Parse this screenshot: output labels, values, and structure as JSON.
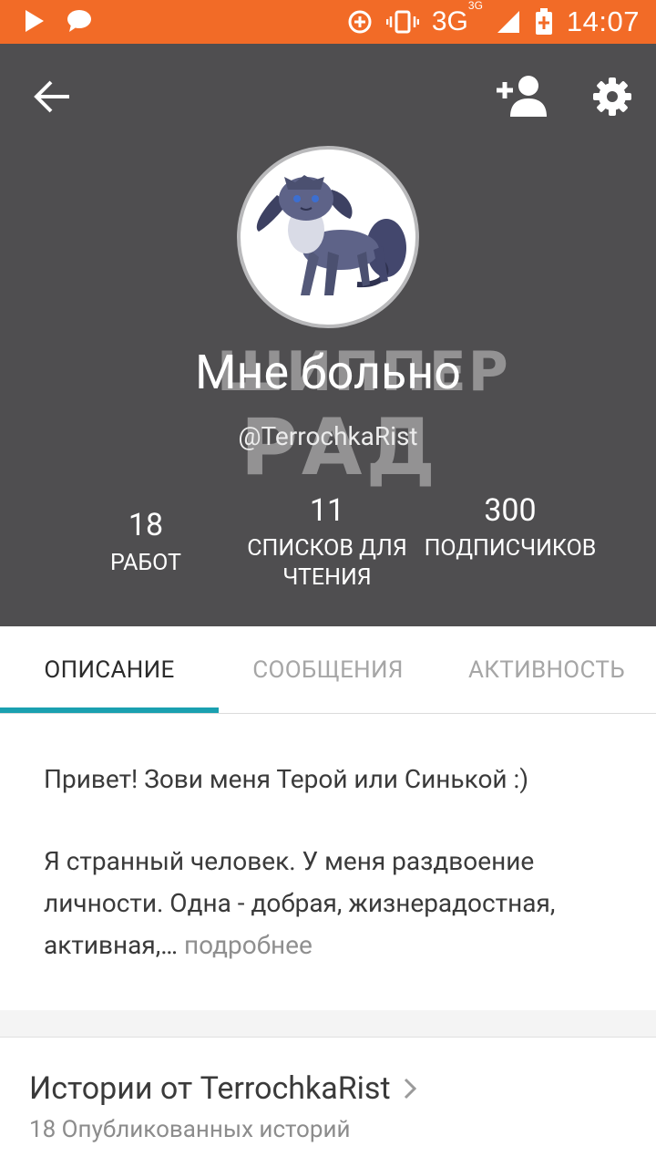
{
  "status_bar": {
    "network": "3G",
    "network_sup": "3G",
    "time": "14:07"
  },
  "profile": {
    "display_name": "Мне больно",
    "username": "@TerrochkaRist",
    "watermark_line1": "ШИППЕР",
    "watermark_line2": "РАД",
    "stats": [
      {
        "value": "18",
        "label": "РАБОТ"
      },
      {
        "value": "11",
        "label": "СПИСКОВ ДЛЯ ЧТЕНИЯ"
      },
      {
        "value": "300",
        "label": "ПОДПИСЧИКОВ"
      }
    ]
  },
  "tabs": [
    {
      "label": "ОПИСАНИЕ",
      "active": true
    },
    {
      "label": "СООБЩЕНИЯ",
      "active": false
    },
    {
      "label": "АКТИВНОСТЬ",
      "active": false
    }
  ],
  "description": {
    "line1": "Привет! Зови меня Терой или Синькой :)",
    "line2": "Я странный человек. У меня раздвоение личности. Одна - добрая, жизнерадостная, активная,…",
    "more": "подробнее"
  },
  "stories": {
    "title": "Истории от TerrochkaRist",
    "subtitle": "18 Опубликованных историй"
  },
  "colors": {
    "status_bar": "#f26b27",
    "header": "#4f4e50",
    "tab_accent": "#1aa0b0"
  }
}
